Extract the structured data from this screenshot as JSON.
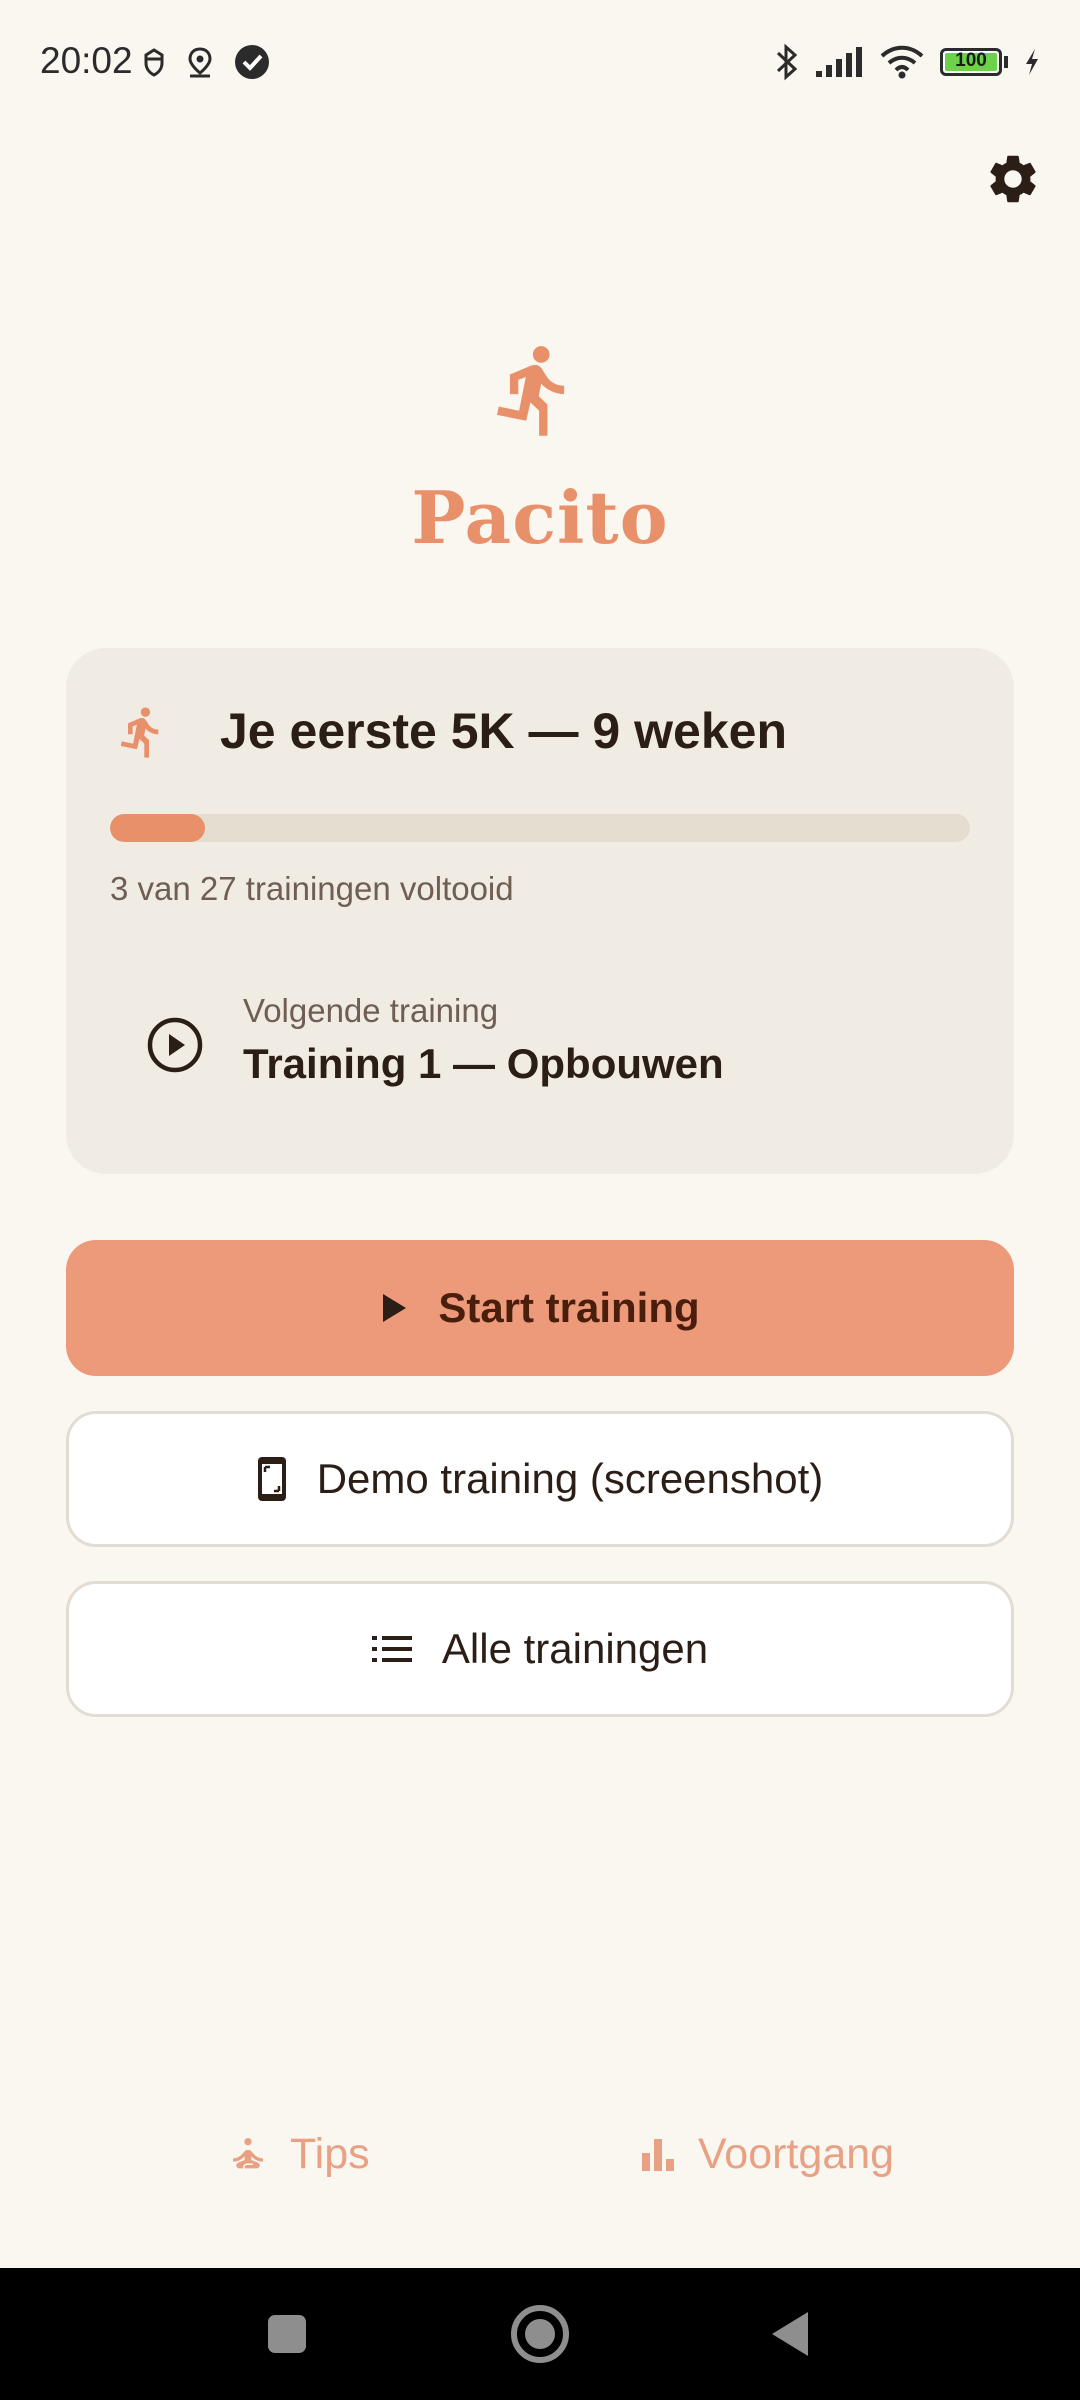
{
  "status_bar": {
    "time": "20:02",
    "battery_level": "100",
    "battery_color": "#6DD24A"
  },
  "header": {
    "settings_icon": "gear-icon"
  },
  "app": {
    "name": "Pacito",
    "logo_icon": "running-person-icon",
    "brand_color": "#E8906A"
  },
  "program": {
    "title": "Je eerste 5K — 9 weken",
    "completed": 3,
    "total": 27,
    "progress_fraction": 0.111,
    "progress_text": "3 van 27 trainingen voltooid",
    "next_label": "Volgende training",
    "next_value": "Training 1 — Opbouwen"
  },
  "actions": {
    "start_label": "Start training",
    "demo_label": "Demo training (screenshot)",
    "all_label": "Alle trainingen"
  },
  "bottom_nav": {
    "tips_label": "Tips",
    "progress_label": "Voortgang"
  }
}
